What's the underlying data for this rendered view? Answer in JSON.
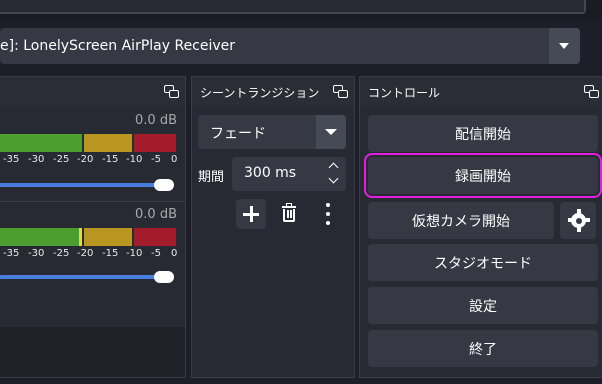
{
  "source": {
    "selected": "e]: LonelyScreen AirPlay Receiver"
  },
  "mixer": {
    "channels": [
      {
        "level_db": "0.0 dB",
        "scale": [
          "-35",
          "-30",
          "-25",
          "-20",
          "-15",
          "-10",
          "-5",
          "0"
        ],
        "volume": 1.0
      },
      {
        "level_db": "0.0 dB",
        "scale": [
          "-35",
          "-30",
          "-25",
          "-20",
          "-15",
          "-10",
          "-5",
          "0"
        ],
        "volume": 1.0
      }
    ],
    "colors": {
      "green": "#4c9e2f",
      "yellow": "#b8961f",
      "red": "#a21c2b",
      "slider": "#4a7de0"
    }
  },
  "transitions": {
    "title": "シーントランジション",
    "selected": "フェード",
    "duration_label": "期間",
    "duration_value": "300 ms"
  },
  "controls": {
    "title": "コントロール",
    "start_streaming": "配信開始",
    "start_recording": "録画開始",
    "start_virtual_camera": "仮想カメラ開始",
    "studio_mode": "スタジオモード",
    "settings": "設定",
    "exit": "終了",
    "highlight_color": "#e31ee0"
  },
  "icons": [
    "float-icon",
    "chevron-down-icon",
    "plus-icon",
    "trash-icon",
    "more-vertical-icon",
    "gear-icon",
    "spin-up-icon",
    "spin-down-icon"
  ]
}
